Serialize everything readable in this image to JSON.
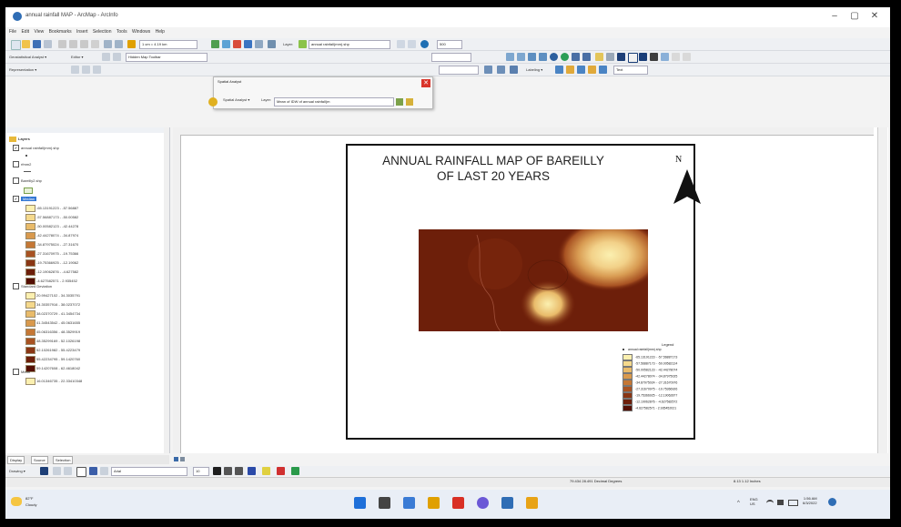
{
  "window": {
    "title": "annual rainfall MAP - ArcMap - ArcInfo",
    "controls": [
      "–",
      "▢",
      "✕"
    ]
  },
  "menu": [
    "File",
    "Edit",
    "View",
    "Bookmarks",
    "Insert",
    "Selection",
    "Tools",
    "Windows",
    "Help"
  ],
  "toolbar1": {
    "scale_value": "1 cm = 4.19 km",
    "layer_label": "Layer:",
    "layer_value": "annual rainfall(mm).shp",
    "zoom_value": "500"
  },
  "toolbar2": {
    "geostat_label": "Geostatistical Analyst ▾",
    "editor_label": "Editor ▾",
    "layout_combo": "Hidden Map Toolbar"
  },
  "toolbar3": {
    "representation_label": "Representation ▾",
    "labeling_label": "Labeling ▾",
    "font_value": "Text"
  },
  "spatial_popup": {
    "title": "Spatial Analyst",
    "dropdown_label": "Spatial Analyst ▾",
    "layer_label": "Layer:",
    "layer_value": "Mean of IDW of annual rainfall(m"
  },
  "toc": {
    "root": "Layers",
    "layers": [
      {
        "name": "annual rainfall(mm).shp",
        "checked": true
      },
      {
        "name": "rfmm2",
        "checked": false
      },
      {
        "name": "Bareilly2.shp",
        "checked": false
      }
    ],
    "median_group": {
      "name": "Median",
      "classes": [
        "-65.13191223 - -57.56887",
        "-57.56887173 - -50.00582",
        "-50.00582123 - -42.44278",
        "-42.44278074 - -34.87974",
        "-34.87975024 - -27.31670",
        "-27.31670975 - -19.75366",
        "-19.75366925 - -12.19062",
        "-12.19062876 - -4.627582",
        "-4.627582571 - 2.935452"
      ]
    },
    "stddev_group": {
      "name": "Standard Deviation",
      "classes": [
        "20.99427102 - 34.3035791",
        "34.30357916 - 38.0237072",
        "38.02370729 - 41.3454734",
        "41.34543542 - 45.0631655",
        "45.06316356 - 48.3529919",
        "48.35299169 - 52.1026198",
        "52.10261982 - 55.4223479",
        "55.42234795 - 59.1420760",
        "59.14207608 - 62.4618042"
      ]
    },
    "mean_group": {
      "name": "Mean",
      "classes": [
        "16.01346735 - 22.33410348"
      ]
    },
    "ramp_colors": [
      "#fbf0b0",
      "#f5d98c",
      "#e9bb6a",
      "#d9994d",
      "#c57735",
      "#a85222",
      "#8a3614",
      "#6d1f0a",
      "#540f04"
    ]
  },
  "map": {
    "title_line1": "ANNUAL RAINFALL MAP OF BAREILLY",
    "title_line2": "OF LAST 20 YEARS",
    "north_label": "N"
  },
  "legend": {
    "title": "Legend",
    "point_label": "annual rainfall(mm).shp",
    "classes": [
      "-65.13191223 - -57.56887173",
      "-57.56887173 - -50.00582124",
      "-50.00582123 - -42.44278074",
      "-42.44278074 - -34.87975025",
      "-34.87975024 - -27.31670976",
      "-27.31670975 - -19.75366926",
      "-19.75366925 - -12.19062877",
      "-12.19062876 - -4.627582572",
      "-4.627582571 - 2.935452021"
    ]
  },
  "bottom_tabs": [
    "Display",
    "Source",
    "Selection"
  ],
  "drawing": {
    "label": "Drawing ▾",
    "font": "Arial",
    "size": "10"
  },
  "status": {
    "coords": "79.434  28.491 Decimal Degrees",
    "page": "8.13  1.12 Inches"
  },
  "taskbar": {
    "weather_temp": "82°F",
    "weather_desc": "Cloudy",
    "lang": "ENG",
    "region": "US",
    "time": "1:56 AM",
    "date": "6/3/2022",
    "app_colors": [
      "#1e6fd9",
      "#444",
      "#3a7bd5",
      "#e0a000",
      "#d93025",
      "#6b58d6",
      "#2f6db5",
      "#e8a317"
    ]
  }
}
